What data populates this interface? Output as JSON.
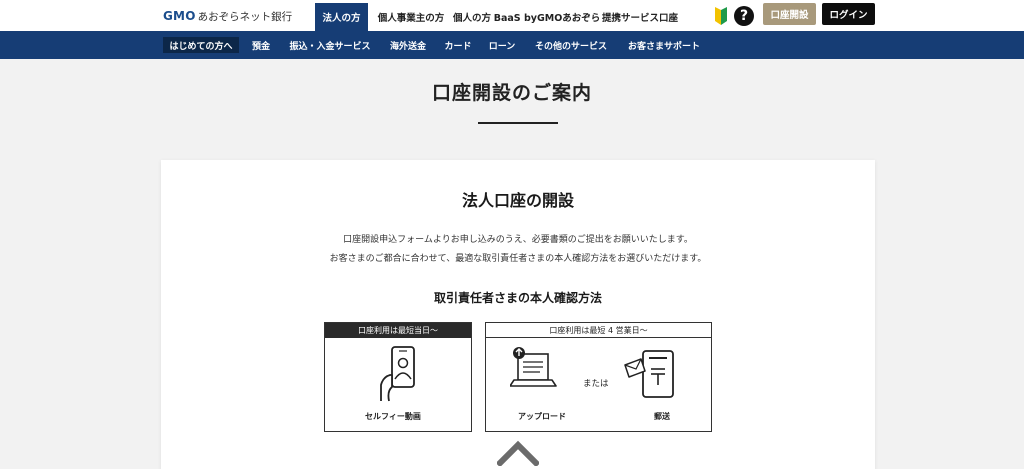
{
  "header": {
    "logo_brand": "GMO",
    "logo_name": "あおぞらネット銀行",
    "tabs": [
      {
        "label": "法人の方",
        "active": true
      },
      {
        "label": "個人事業主の方"
      },
      {
        "label": "個人の方"
      },
      {
        "label": "BaaS byGMOあおぞら"
      },
      {
        "label": "提携サービス口座"
      }
    ],
    "beginner_icon": "beginner-leaf-icon",
    "help_icon": "question-icon",
    "help_glyph": "?",
    "open_account_label": "口座開設",
    "login_label": "ログイン",
    "colors": {
      "brand_navy": "#163d75",
      "open_btn": "#a8997b",
      "login_btn": "#0d0d0d"
    }
  },
  "nav": {
    "items": [
      {
        "label": "はじめての方へ",
        "active": true
      },
      {
        "label": "預金"
      },
      {
        "label": "振込・入金サービス"
      },
      {
        "label": "海外送金"
      },
      {
        "label": "カード"
      },
      {
        "label": "ローン"
      },
      {
        "label": "その他のサービス"
      },
      {
        "label": "お客さまサポート"
      }
    ]
  },
  "page": {
    "title": "口座開設のご案内"
  },
  "card": {
    "title": "法人口座の開設",
    "desc_line1": "口座開設申込フォームよりお申し込みのうえ、必要書類のご提出をお願いいたします。",
    "desc_line2": "お客さまのご都合に合わせて、最適な取引責任者さまの本人確認方法をお選びいただけます。",
    "subtitle": "取引責任者さまの本人確認方法",
    "option_selfie": {
      "head": "口座利用は最短当日〜",
      "icon": "smartphone-selfie-icon",
      "label": "セルフィー動画"
    },
    "option_upload_mail": {
      "head": "口座利用は最短 4 営業日〜",
      "upload_icon": "laptop-upload-icon",
      "upload_label": "アップロード",
      "or_text": "または",
      "mail_icon": "postbox-icon",
      "mail_label": "郵送"
    }
  },
  "scroll": {
    "icon": "chevron-up-icon"
  }
}
